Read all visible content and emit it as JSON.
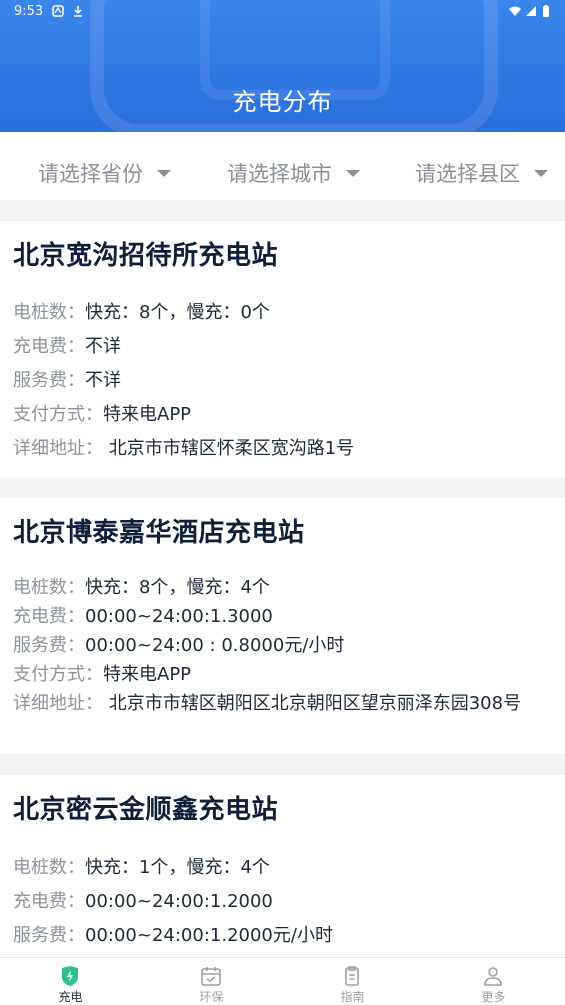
{
  "status_bar": {
    "time": "9:53"
  },
  "header": {
    "title": "充电分布"
  },
  "filters": [
    {
      "label": "请选择省份"
    },
    {
      "label": "请选择城市"
    },
    {
      "label": "请选择县区"
    }
  ],
  "labels": {
    "piles": "电桩数：",
    "charge_fee": "充电费：",
    "service_fee": "服务费：",
    "payment": "支付方式：",
    "address": "详细地址："
  },
  "stations": [
    {
      "name": "北京宽沟招待所充电站",
      "piles": "快充：8个，慢充：0个",
      "charge_fee": "不详",
      "service_fee": "不详",
      "payment": "特来电APP",
      "address": "北京市市辖区怀柔区宽沟路1号"
    },
    {
      "name": "北京博泰嘉华酒店充电站",
      "piles": "快充：8个，慢充：4个",
      "charge_fee": "00:00~24:00:1.3000",
      "service_fee": "00:00~24:00 : 0.8000元/小时",
      "payment": "特来电APP",
      "address": "北京市市辖区朝阳区北京朝阳区望京丽泽东园308号"
    },
    {
      "name": "北京密云金顺鑫充电站",
      "piles": "快充：1个，慢充：4个",
      "charge_fee": "00:00~24:00:1.2000",
      "service_fee": "00:00~24:00:1.2000元/小时"
    }
  ],
  "tabs": [
    {
      "label": "充电",
      "icon": "charging-shield-icon",
      "active": true,
      "color": "#2fbf8f"
    },
    {
      "label": "环保",
      "icon": "calendar-icon",
      "active": false
    },
    {
      "label": "指南",
      "icon": "clipboard-icon",
      "active": false
    },
    {
      "label": "更多",
      "icon": "person-icon",
      "active": false
    }
  ],
  "colors": {
    "header": "#2f78e3",
    "label": "#8d939c",
    "accent": "#2fbf8f"
  }
}
